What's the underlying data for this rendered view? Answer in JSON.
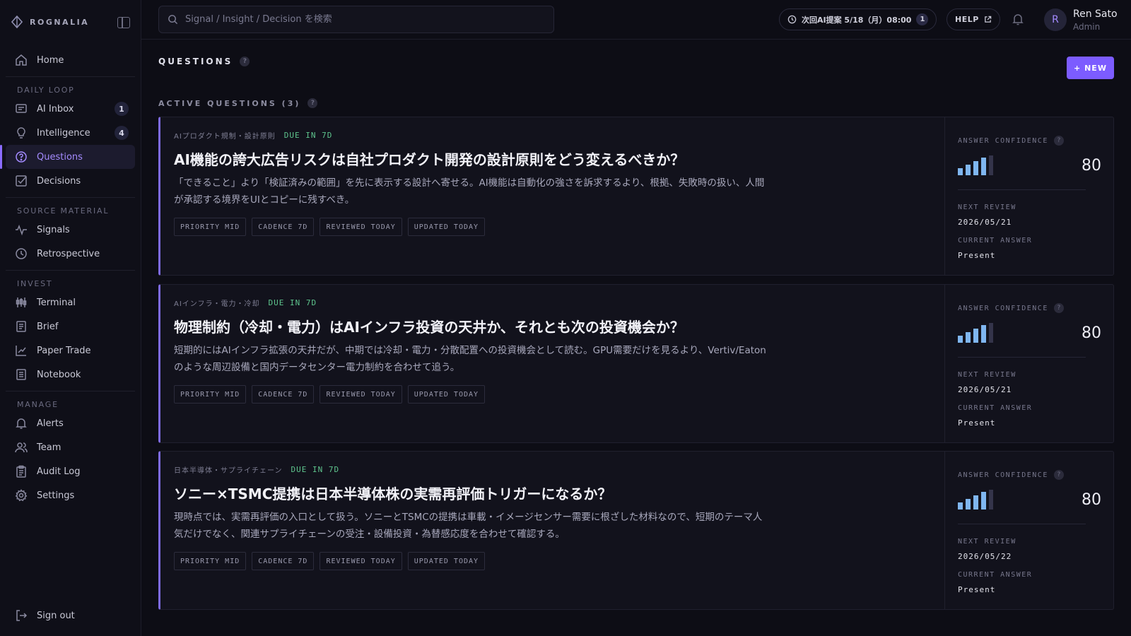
{
  "app": {
    "brand": "ROGNALIA"
  },
  "sidebar": {
    "home": "Home",
    "sections": {
      "daily_loop": "DAILY LOOP",
      "source_material": "SOURCE MATERIAL",
      "invest": "INVEST",
      "manage": "MANAGE"
    },
    "items": {
      "ai_inbox": {
        "label": "AI Inbox",
        "badge": "1"
      },
      "intelligence": {
        "label": "Intelligence",
        "badge": "4"
      },
      "questions": {
        "label": "Questions"
      },
      "decisions": {
        "label": "Decisions"
      },
      "signals": {
        "label": "Signals"
      },
      "retrospective": {
        "label": "Retrospective"
      },
      "terminal": {
        "label": "Terminal"
      },
      "brief": {
        "label": "Brief"
      },
      "paper_trade": {
        "label": "Paper Trade"
      },
      "notebook": {
        "label": "Notebook"
      },
      "alerts": {
        "label": "Alerts"
      },
      "team": {
        "label": "Team"
      },
      "audit_log": {
        "label": "Audit Log"
      },
      "settings": {
        "label": "Settings"
      }
    },
    "sign_out": "Sign out"
  },
  "topbar": {
    "search_placeholder": "Signal / Insight / Decision を検索",
    "next_ai": "次回AI提案 5/18（月）08:00",
    "next_ai_count": "1",
    "help": "HELP",
    "user": {
      "initial": "R",
      "name": "Ren Sato",
      "role": "Admin"
    }
  },
  "main": {
    "title": "QUESTIONS",
    "new_button": "+ NEW",
    "section": "ACTIVE QUESTIONS (3)",
    "labels": {
      "confidence": "ANSWER CONFIDENCE",
      "next_review": "NEXT REVIEW",
      "current_answer": "CURRENT ANSWER"
    },
    "questions": [
      {
        "topic": "AIプロダクト規制・設計原則",
        "due": "DUE IN 7D",
        "title": "AI機能の誇大広告リスクは自社プロダクト開発の設計原則をどう変えるべきか？",
        "desc": "「できること」より「検証済みの範囲」を先に表示する設計へ寄せる。AI機能は自動化の強さを訴求するより、根拠、失敗時の扱い、人間が承認する境界をUIとコピーに残すべき。",
        "tags": [
          "PRIORITY MID",
          "CADENCE 7D",
          "REVIEWED TODAY",
          "UPDATED TODAY"
        ],
        "confidence": "80",
        "next_review": "2026/05/21",
        "current_answer": "Present"
      },
      {
        "topic": "AIインフラ・電力・冷却",
        "due": "DUE IN 7D",
        "title": "物理制約（冷却・電力）はAIインフラ投資の天井か、それとも次の投資機会か？",
        "desc": "短期的にはAIインフラ拡張の天井だが、中期では冷却・電力・分散配置への投資機会として読む。GPU需要だけを見るより、Vertiv/Eatonのような周辺設備と国内データセンター電力制約を合わせて追う。",
        "tags": [
          "PRIORITY MID",
          "CADENCE 7D",
          "REVIEWED TODAY",
          "UPDATED TODAY"
        ],
        "confidence": "80",
        "next_review": "2026/05/21",
        "current_answer": "Present"
      },
      {
        "topic": "日本半導体・サプライチェーン",
        "due": "DUE IN 7D",
        "title": "ソニー×TSMC提携は日本半導体株の実需再評価トリガーになるか？",
        "desc": "現時点では、実需再評価の入口として扱う。ソニーとTSMCの提携は車載・イメージセンサー需要に根ざした材料なので、短期のテーマ人気だけでなく、関連サプライチェーンの受注・設備投資・為替感応度を合わせて確認する。",
        "tags": [
          "PRIORITY MID",
          "CADENCE 7D",
          "REVIEWED TODAY",
          "UPDATED TODAY"
        ],
        "confidence": "80",
        "next_review": "2026/05/22",
        "current_answer": "Present"
      }
    ]
  }
}
